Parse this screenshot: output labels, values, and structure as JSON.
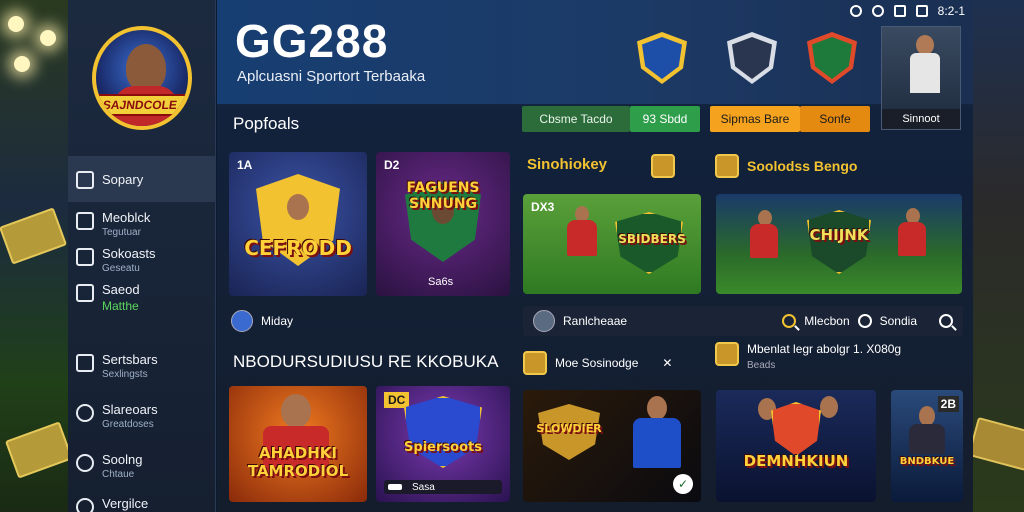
{
  "status": {
    "time": "8:2-1"
  },
  "sidebar": {
    "logo_text": "SAJNDCOLE",
    "items": [
      {
        "label": "Sopary",
        "sub": ""
      },
      {
        "label": "Meoblck",
        "sub": "Tegutuar"
      },
      {
        "label": "Sokoasts",
        "sub": "Geseatu"
      },
      {
        "label": "Saeod",
        "sub": "Matthe"
      },
      {
        "label": "Sertsbars",
        "sub": "Sexlingsts"
      },
      {
        "label": "Slareoars",
        "sub": "Greatdoses"
      },
      {
        "label": "Soolng",
        "sub": "Chtaue"
      },
      {
        "label": "Vergilce",
        "sub": ""
      }
    ]
  },
  "header": {
    "title": "GG288",
    "subtitle": "Aplcuasni Sportort Terbaaka",
    "promo_label": "Sinnoot"
  },
  "sections": {
    "popular": "Popfoals",
    "bar_a_1": "Cbsme Tacdo",
    "bar_a_2": "93 Sbdd",
    "bar_b_1": "Sipmas Bare",
    "bar_b_2": "Sonfe",
    "monkey": "Sinohiokey",
    "solocess": "Soolodss Bengo",
    "today": "Miday",
    "row_label": "Ranlcheaae",
    "row_mid": "Mlecbon",
    "row_right": "Sondia",
    "big_heading": "NBODURSUDIUSU RE KKOBUKA",
    "promo_left": "Moe Sosinodge",
    "promo_right_title": "Mbenlat legr abolgr 1. X080g",
    "promo_right_sub": "Beads"
  },
  "cards": [
    {
      "tag": "1A",
      "title": "CEFRODD",
      "caption": ""
    },
    {
      "tag": "D2",
      "title": "FAGUENS SNNUNG",
      "caption": "Sa6s"
    },
    {
      "tag": "DX3",
      "title": "SBIDBERS",
      "caption": ""
    },
    {
      "tag": "",
      "title": "CHIJNK",
      "caption": ""
    },
    {
      "tag": "",
      "title": "AHADHKI TAMRODIOL",
      "caption": ""
    },
    {
      "tag": "DC",
      "title": "Spiersoots",
      "caption": "Sasa"
    },
    {
      "tag": "",
      "title": "SLOWDIER",
      "caption": ""
    },
    {
      "tag": "",
      "title": "DEMNHKIUN",
      "caption": ""
    },
    {
      "tag": "2B",
      "title": "BNDBKUE",
      "caption": ""
    }
  ],
  "colors": {
    "accent_gold": "#f2c230",
    "pill_green": "#2e9e4a",
    "pill_orange": "#f5a21f"
  }
}
